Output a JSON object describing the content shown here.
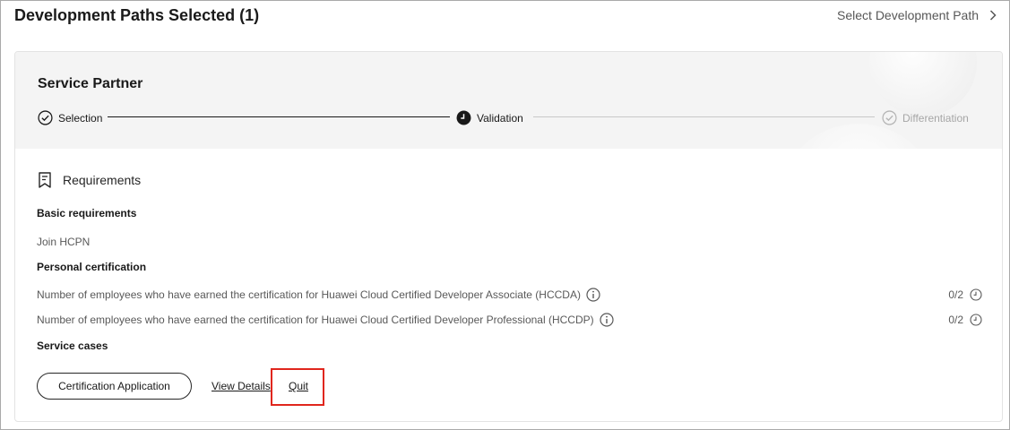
{
  "header": {
    "title": "Development Paths Selected (1)",
    "select_path_label": "Select Development Path"
  },
  "card": {
    "path_name": "Service Partner",
    "steps": [
      {
        "label": "Selection",
        "state": "completed"
      },
      {
        "label": "Validation",
        "state": "current"
      },
      {
        "label": "Differentiation",
        "state": "pending"
      }
    ],
    "requirements_title": "Requirements",
    "basic_title": "Basic requirements",
    "basic_items": [
      "Join HCPN"
    ],
    "personal_title": "Personal certification",
    "personal_items": [
      {
        "label": "Number of employees who have earned the certification for Huawei Cloud Certified Developer Associate (HCCDA)",
        "count": "0/2"
      },
      {
        "label": "Number of employees who have earned the certification for Huawei Cloud Certified Developer Professional (HCCDP)",
        "count": "0/2"
      }
    ],
    "service_title": "Service cases",
    "actions": {
      "cert_button": "Certification Application",
      "view_details": "View Details",
      "quit": "Quit"
    }
  },
  "colors": {
    "highlight": "#e0261d",
    "text_primary": "#191919",
    "text_secondary": "#595959",
    "pending": "#a6a6a6"
  }
}
